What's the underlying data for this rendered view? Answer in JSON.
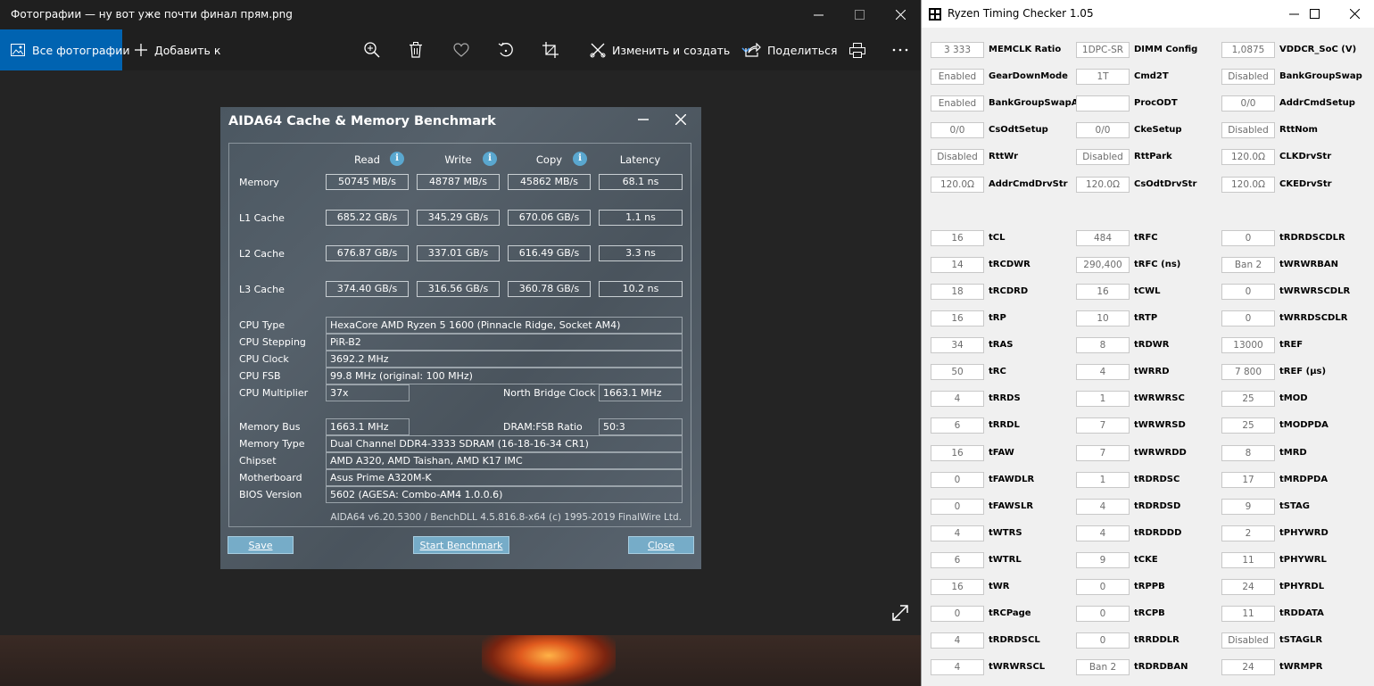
{
  "photos": {
    "window_title": "Фотографии — ну вот уже почти финал прям.png",
    "toolbar": {
      "all_photos": "Все фотографии",
      "add_to": "Добавить к",
      "edit_create": "Изменить и создать",
      "share": "Поделиться"
    }
  },
  "aida": {
    "title": "AIDA64 Cache & Memory Benchmark",
    "columns": [
      "Read",
      "Write",
      "Copy",
      "Latency"
    ],
    "bench_rows": [
      {
        "label": "Memory",
        "values": [
          "50745 MB/s",
          "48787 MB/s",
          "45862 MB/s",
          "68.1 ns"
        ]
      },
      {
        "label": "L1 Cache",
        "values": [
          "685.22 GB/s",
          "345.29 GB/s",
          "670.06 GB/s",
          "1.1 ns"
        ]
      },
      {
        "label": "L2 Cache",
        "values": [
          "676.87 GB/s",
          "337.01 GB/s",
          "616.49 GB/s",
          "3.3 ns"
        ]
      },
      {
        "label": "L3 Cache",
        "values": [
          "374.40 GB/s",
          "316.56 GB/s",
          "360.78 GB/s",
          "10.2 ns"
        ]
      }
    ],
    "cpu_type_label": "CPU Type",
    "cpu_type": "HexaCore AMD Ryzen 5 1600  (Pinnacle Ridge, Socket AM4)",
    "cpu_stepping_label": "CPU Stepping",
    "cpu_stepping": "PiR-B2",
    "cpu_clock_label": "CPU Clock",
    "cpu_clock": "3692.2 MHz",
    "cpu_fsb_label": "CPU FSB",
    "cpu_fsb": "99.8 MHz  (original: 100 MHz)",
    "cpu_multiplier_label": "CPU Multiplier",
    "cpu_multiplier": "37x",
    "nb_clock_label": "North Bridge Clock",
    "nb_clock": "1663.1 MHz",
    "memory_bus_label": "Memory Bus",
    "memory_bus": "1663.1 MHz",
    "dram_fsb_label": "DRAM:FSB Ratio",
    "dram_fsb": "50:3",
    "memory_type_label": "Memory Type",
    "memory_type": "Dual Channel DDR4-3333 SDRAM  (16-18-16-34 CR1)",
    "chipset_label": "Chipset",
    "chipset": "AMD A320, AMD Taishan, AMD K17 IMC",
    "motherboard_label": "Motherboard",
    "motherboard": "Asus Prime A320M-K",
    "bios_label": "BIOS Version",
    "bios": "5602  (AGESA: Combo-AM4 1.0.0.6)",
    "footer": "AIDA64 v6.20.5300 / BenchDLL 4.5.816.8-x64  (c) 1995-2019 FinalWire Ltd.",
    "save": "Save",
    "start": "Start Benchmark",
    "close": "Close"
  },
  "rtc": {
    "title": "Ryzen Timing Checker 1.05",
    "fields": [
      {
        "col": 0,
        "row": 0,
        "value": "3 333",
        "label": "MEMCLK Ratio"
      },
      {
        "col": 1,
        "row": 0,
        "value": "1DPC-SR",
        "label": "DIMM Config"
      },
      {
        "col": 2,
        "row": 0,
        "value": "1,0875",
        "label": "VDDCR_SoC (V)"
      },
      {
        "col": 0,
        "row": 1,
        "value": "Enabled",
        "label": "GearDownMode"
      },
      {
        "col": 1,
        "row": 1,
        "value": "1T",
        "label": "Cmd2T"
      },
      {
        "col": 2,
        "row": 1,
        "value": "Disabled",
        "label": "BankGroupSwap"
      },
      {
        "col": 0,
        "row": 2,
        "value": "Enabled",
        "label": "BankGroupSwapAlt"
      },
      {
        "col": 1,
        "row": 2,
        "value": "",
        "label": "ProcODT"
      },
      {
        "col": 2,
        "row": 2,
        "value": "0/0",
        "label": "AddrCmdSetup"
      },
      {
        "col": 0,
        "row": 3,
        "value": "0/0",
        "label": "CsOdtSetup"
      },
      {
        "col": 1,
        "row": 3,
        "value": "0/0",
        "label": "CkeSetup"
      },
      {
        "col": 2,
        "row": 3,
        "value": "Disabled",
        "label": "RttNom"
      },
      {
        "col": 0,
        "row": 4,
        "value": "Disabled",
        "label": "RttWr"
      },
      {
        "col": 1,
        "row": 4,
        "value": "Disabled",
        "label": "RttPark"
      },
      {
        "col": 2,
        "row": 4,
        "value": "120.0Ω",
        "label": "CLKDrvStr"
      },
      {
        "col": 0,
        "row": 5,
        "value": "120.0Ω",
        "label": "AddrCmdDrvStr"
      },
      {
        "col": 1,
        "row": 5,
        "value": "120.0Ω",
        "label": "CsOdtDrvStr"
      },
      {
        "col": 2,
        "row": 5,
        "value": "120.0Ω",
        "label": "CKEDrvStr"
      },
      {
        "col": 0,
        "row": 7,
        "value": "16",
        "label": "tCL"
      },
      {
        "col": 1,
        "row": 7,
        "value": "484",
        "label": "tRFC"
      },
      {
        "col": 2,
        "row": 7,
        "value": "0",
        "label": "tRDRDSCDLR"
      },
      {
        "col": 0,
        "row": 8,
        "value": "14",
        "label": "tRCDWR"
      },
      {
        "col": 1,
        "row": 8,
        "value": "290,400",
        "label": "tRFC (ns)"
      },
      {
        "col": 2,
        "row": 8,
        "value": "Ban 2",
        "label": "tWRWRBAN"
      },
      {
        "col": 0,
        "row": 9,
        "value": "18",
        "label": "tRCDRD"
      },
      {
        "col": 1,
        "row": 9,
        "value": "16",
        "label": "tCWL"
      },
      {
        "col": 2,
        "row": 9,
        "value": "0",
        "label": "tWRWRSCDLR"
      },
      {
        "col": 0,
        "row": 10,
        "value": "16",
        "label": "tRP"
      },
      {
        "col": 1,
        "row": 10,
        "value": "10",
        "label": "tRTP"
      },
      {
        "col": 2,
        "row": 10,
        "value": "0",
        "label": "tWRRDSCDLR"
      },
      {
        "col": 0,
        "row": 11,
        "value": "34",
        "label": "tRAS"
      },
      {
        "col": 1,
        "row": 11,
        "value": "8",
        "label": "tRDWR"
      },
      {
        "col": 2,
        "row": 11,
        "value": "13000",
        "label": "tREF"
      },
      {
        "col": 0,
        "row": 12,
        "value": "50",
        "label": "tRC"
      },
      {
        "col": 1,
        "row": 12,
        "value": "4",
        "label": "tWRRD"
      },
      {
        "col": 2,
        "row": 12,
        "value": "7 800",
        "label": "tREF (µs)"
      },
      {
        "col": 0,
        "row": 13,
        "value": "4",
        "label": "tRRDS"
      },
      {
        "col": 1,
        "row": 13,
        "value": "1",
        "label": "tWRWRSC"
      },
      {
        "col": 2,
        "row": 13,
        "value": "25",
        "label": "tMOD"
      },
      {
        "col": 0,
        "row": 14,
        "value": "6",
        "label": "tRRDL"
      },
      {
        "col": 1,
        "row": 14,
        "value": "7",
        "label": "tWRWRSD"
      },
      {
        "col": 2,
        "row": 14,
        "value": "25",
        "label": "tMODPDA"
      },
      {
        "col": 0,
        "row": 15,
        "value": "16",
        "label": "tFAW"
      },
      {
        "col": 1,
        "row": 15,
        "value": "7",
        "label": "tWRWRDD"
      },
      {
        "col": 2,
        "row": 15,
        "value": "8",
        "label": "tMRD"
      },
      {
        "col": 0,
        "row": 16,
        "value": "0",
        "label": "tFAWDLR"
      },
      {
        "col": 1,
        "row": 16,
        "value": "1",
        "label": "tRDRDSC"
      },
      {
        "col": 2,
        "row": 16,
        "value": "17",
        "label": "tMRDPDA"
      },
      {
        "col": 0,
        "row": 17,
        "value": "0",
        "label": "tFAWSLR"
      },
      {
        "col": 1,
        "row": 17,
        "value": "4",
        "label": "tRDRDSD"
      },
      {
        "col": 2,
        "row": 17,
        "value": "9",
        "label": "tSTAG"
      },
      {
        "col": 0,
        "row": 18,
        "value": "4",
        "label": "tWTRS"
      },
      {
        "col": 1,
        "row": 18,
        "value": "4",
        "label": "tRDRDDD"
      },
      {
        "col": 2,
        "row": 18,
        "value": "2",
        "label": "tPHYWRD"
      },
      {
        "col": 0,
        "row": 19,
        "value": "6",
        "label": "tWTRL"
      },
      {
        "col": 1,
        "row": 19,
        "value": "9",
        "label": "tCKE"
      },
      {
        "col": 2,
        "row": 19,
        "value": "11",
        "label": "tPHYWRL"
      },
      {
        "col": 0,
        "row": 20,
        "value": "16",
        "label": "tWR"
      },
      {
        "col": 1,
        "row": 20,
        "value": "0",
        "label": "tRPPB"
      },
      {
        "col": 2,
        "row": 20,
        "value": "24",
        "label": "tPHYRDL"
      },
      {
        "col": 0,
        "row": 21,
        "value": "0",
        "label": "tRCPage"
      },
      {
        "col": 1,
        "row": 21,
        "value": "0",
        "label": "tRCPB"
      },
      {
        "col": 2,
        "row": 21,
        "value": "11",
        "label": "tRDDATA"
      },
      {
        "col": 0,
        "row": 22,
        "value": "4",
        "label": "tRDRDSCL"
      },
      {
        "col": 1,
        "row": 22,
        "value": "0",
        "label": "tRRDDLR"
      },
      {
        "col": 2,
        "row": 22,
        "value": "Disabled",
        "label": "tSTAGLR"
      },
      {
        "col": 0,
        "row": 23,
        "value": "4",
        "label": "tWRWRSCL"
      },
      {
        "col": 1,
        "row": 23,
        "value": "Ban 2",
        "label": "tRDRDBAN"
      },
      {
        "col": 2,
        "row": 23,
        "value": "24",
        "label": "tWRMPR"
      }
    ]
  }
}
